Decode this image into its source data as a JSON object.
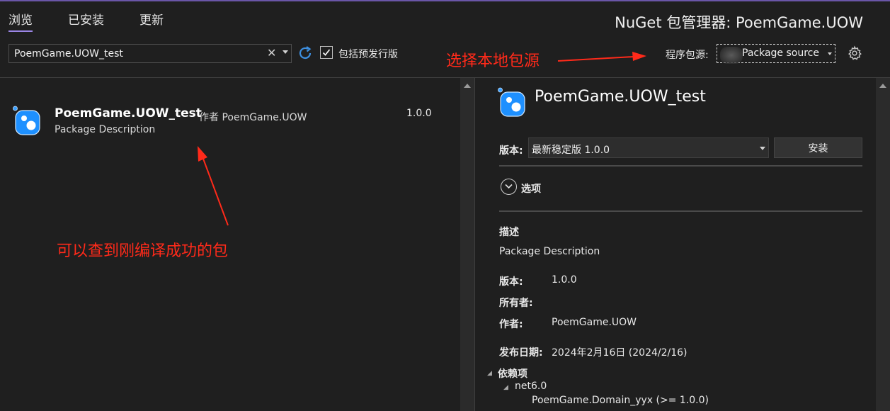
{
  "tabs": [
    {
      "label": "浏览",
      "active": true
    },
    {
      "label": "已安装",
      "active": false
    },
    {
      "label": "更新",
      "active": false
    }
  ],
  "window_title": "NuGet 包管理器: PoemGame.UOW",
  "search": {
    "value": "PoemGame.UOW_test",
    "clear_glyph": "✕"
  },
  "prerelease": {
    "label": "包括预发行版",
    "checked": true
  },
  "package_source": {
    "label": "程序包源:",
    "value": "Package source"
  },
  "annotations": {
    "select_source": "选择本地包源",
    "found_package": "可以查到刚编译成功的包"
  },
  "package_list": [
    {
      "name": "PoemGame.UOW_test",
      "author": "作者 PoemGame.UOW",
      "description": "Package Description",
      "version": "1.0.0"
    }
  ],
  "details": {
    "title": "PoemGame.UOW_test",
    "version_label": "版本:",
    "version_select": "最新稳定版 1.0.0",
    "install_label": "安装",
    "options_label": "选项",
    "description_label": "描述",
    "description": "Package Description",
    "version_info_label": "版本:",
    "version_info": "1.0.0",
    "owners_label": "所有者:",
    "owners": "",
    "authors_label": "作者:",
    "authors": "PoemGame.UOW",
    "publish_date_label": "发布日期:",
    "publish_date": "2024年2月16日 (2024/2/16)",
    "dependencies_label": "依赖项",
    "dependency_framework": "net6.0",
    "dependency_item": "PoemGame.Domain_yyx (>= 1.0.0)"
  },
  "colors": {
    "background": "#1f1f1f",
    "accent": "#9b86e6",
    "annotation_red": "#ff2a1a",
    "icon_blue": "#1e90ff"
  },
  "icons": [
    "refresh-icon",
    "check-icon",
    "gear-icon",
    "package-icon",
    "chevron-down-icon"
  ]
}
